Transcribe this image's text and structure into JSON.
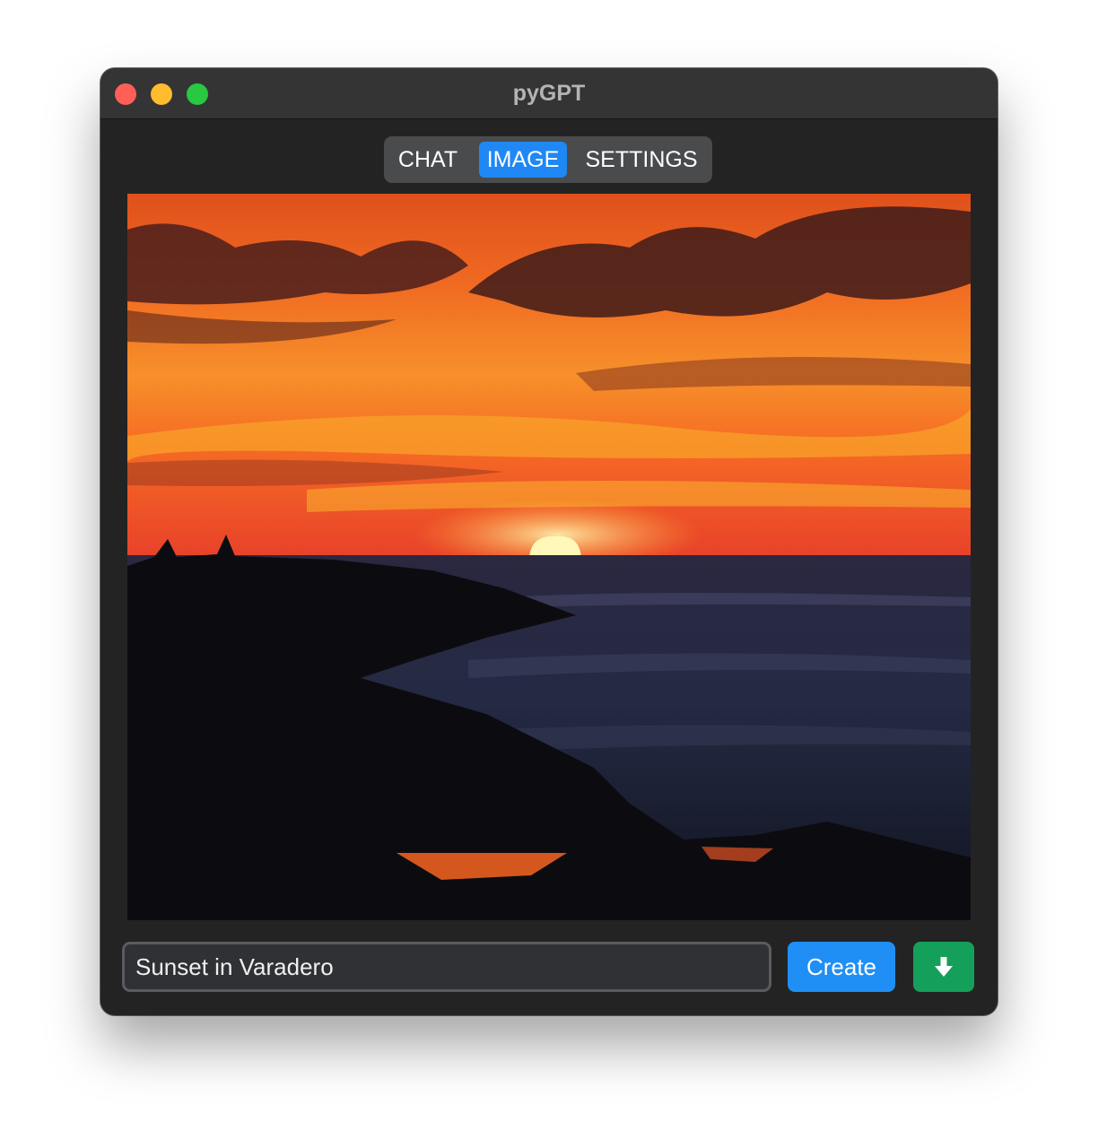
{
  "window": {
    "title": "pyGPT"
  },
  "tabs": [
    {
      "label": "CHAT",
      "active": false
    },
    {
      "label": "IMAGE",
      "active": true
    },
    {
      "label": "SETTINGS",
      "active": false
    }
  ],
  "image": {
    "subject": "Sunset in Varadero"
  },
  "prompt": {
    "value": "Sunset in Varadero"
  },
  "actions": {
    "create_label": "Create",
    "download_icon": "download-arrow-icon"
  },
  "colors": {
    "accent": "#1f88f5",
    "download": "#14a05a",
    "window_bg": "#232323"
  }
}
